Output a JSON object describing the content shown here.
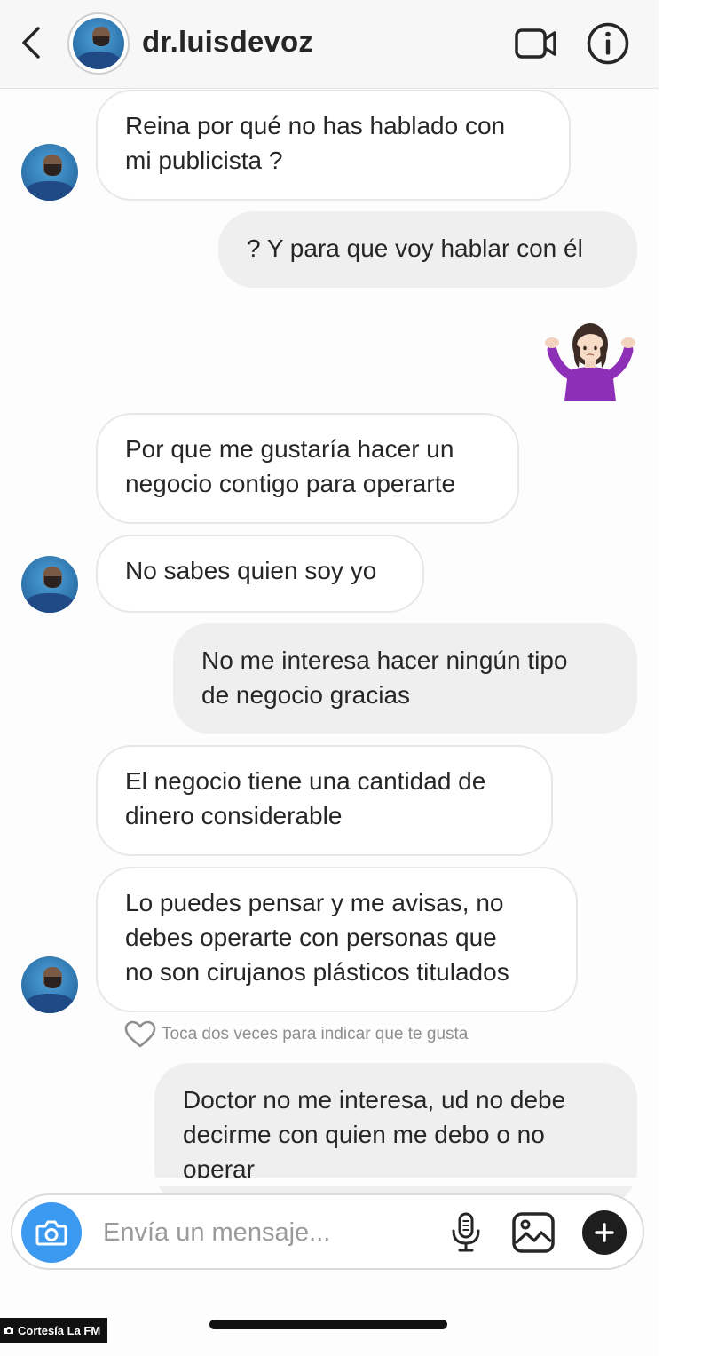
{
  "header": {
    "username": "dr.luisdevoz",
    "icons": {
      "back": "chevron-left-icon",
      "video": "video-camera-icon",
      "info": "info-icon"
    }
  },
  "messages": [
    {
      "sender": "them",
      "text_lines": [
        "Reina por qué no has hablado con",
        "mi publicista ?"
      ]
    },
    {
      "sender": "me",
      "text_lines": [
        "? Y para que voy hablar con él"
      ]
    },
    {
      "sender": "me",
      "emoji": "person-shrugging-emoji"
    },
    {
      "sender": "them",
      "text_lines": [
        "Por que me gustaría hacer un",
        "negocio contigo para operarte"
      ]
    },
    {
      "sender": "them",
      "text_lines": [
        "No sabes quien soy yo"
      ]
    },
    {
      "sender": "me",
      "text_lines": [
        "No me interesa hacer ningún tipo",
        "de negocio gracias"
      ]
    },
    {
      "sender": "them",
      "text_lines": [
        "El negocio tiene una cantidad de",
        "dinero considerable"
      ]
    },
    {
      "sender": "them",
      "text_lines": [
        "Lo puedes pensar y me avisas, no",
        "debes operarte con personas que",
        "no son cirujanos plásticos titulados"
      ]
    },
    {
      "sender": "me",
      "text_lines": [
        "Doctor no me interesa, ud no debe",
        "decirme con quien me debo o no",
        "operar"
      ]
    }
  ],
  "like_hint": "Toca dos veces para indicar que te gusta",
  "composer": {
    "placeholder": "Envía un mensaje...",
    "icons": {
      "camera": "camera-icon",
      "mic": "microphone-icon",
      "gallery": "image-icon",
      "plus": "plus-icon"
    }
  },
  "watermark": "Cortesía La FM",
  "colors": {
    "incoming_bubble": "#ffffff",
    "outgoing_bubble": "#efefef",
    "camera_button": "#3b99f0",
    "text": "#262626"
  }
}
